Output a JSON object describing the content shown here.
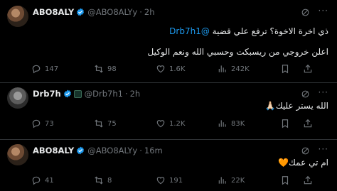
{
  "tweets": [
    {
      "name": "ABO8ALY",
      "handle": "@ABO8ALYy",
      "time": "2h",
      "dot": "·",
      "line1_mention": "@Drb7h1",
      "line1_text": "ذي اخرة الاخوة؟ ترفع علي قضية",
      "line2_text": "اعلن خروجي من ريسبكت وحسبي الله ونعم الوكيل",
      "replies": "147",
      "reposts": "98",
      "likes": "1.6K",
      "views": "242K"
    },
    {
      "name": "Drb7h",
      "handle": "@Drb7h1",
      "time": "2h",
      "dot": "·",
      "text": "الله يستر عليك🙏🏻",
      "replies": "73",
      "reposts": "75",
      "likes": "1.2K",
      "views": "83K"
    },
    {
      "name": "ABO8ALY",
      "handle": "@ABO8ALYy",
      "time": "16m",
      "dot": "·",
      "text": "ام تي عمك🧡",
      "replies": "41",
      "reposts": "8",
      "likes": "191",
      "views": "22K"
    }
  ],
  "colors": {
    "background": "#000000",
    "text": "#e7e9ea",
    "secondary": "#71767b",
    "link": "#1d9bf0",
    "verified": "#1d9bf0"
  },
  "icons": [
    "reply-icon",
    "repost-icon",
    "like-icon",
    "views-icon",
    "bookmark-icon",
    "share-icon",
    "grok-icon",
    "more-icon",
    "verified-icon"
  ]
}
